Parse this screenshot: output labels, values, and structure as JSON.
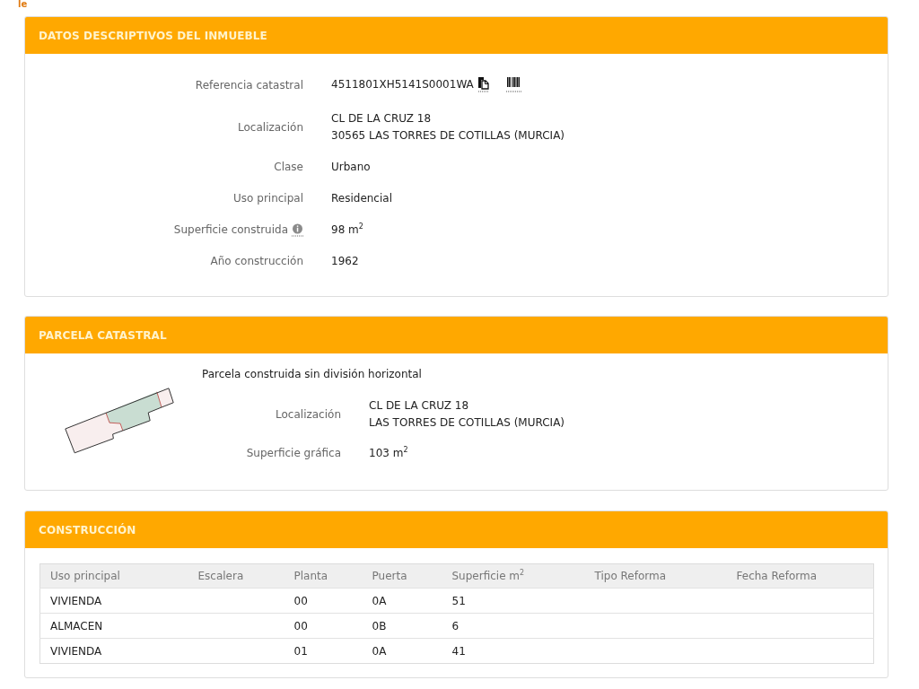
{
  "page_fragment": "le",
  "inmueble": {
    "title": "DATOS DESCRIPTIVOS DEL INMUEBLE",
    "fields": [
      {
        "kind": "reference",
        "label": "Referencia catastral",
        "lines": [
          "4511801XH5141S0001WA"
        ]
      },
      {
        "kind": "text",
        "label": "Localización",
        "lines": [
          "CL DE LA CRUZ 18",
          "30565 LAS TORRES DE COTILLAS (MURCIA)"
        ]
      },
      {
        "kind": "text",
        "label": "Clase",
        "lines": [
          "Urbano"
        ]
      },
      {
        "kind": "text",
        "label": "Uso principal",
        "lines": [
          "Residencial"
        ]
      },
      {
        "kind": "info",
        "label": "Superficie construida",
        "lines": [
          "98 m$^{2}$"
        ]
      },
      {
        "kind": "text",
        "label": "Año construcción",
        "lines": [
          "1962"
        ]
      }
    ]
  },
  "parcela": {
    "title": "PARCELA CATASTRAL",
    "subtitle": "Parcela construida sin división horizontal",
    "fields": [
      {
        "kind": "text",
        "label": "Localización",
        "lines": [
          "CL DE LA CRUZ 18",
          "LAS TORRES DE COTILLAS (MURCIA)"
        ]
      },
      {
        "kind": "text",
        "label": "Superficie gráfica",
        "lines": [
          "103 m$^{2}$"
        ]
      }
    ]
  },
  "construccion": {
    "title": "CONSTRUCCIÓN",
    "table": {
      "columns": [
        "Uso principal",
        "Escalera",
        "Planta",
        "Puerta",
        "Superficie m$^{2}$",
        "Tipo Reforma",
        "Fecha Reforma"
      ],
      "rows": [
        {
          "uso_principal": "VIVIENDA",
          "planta": "00",
          "puerta": "0A",
          "superficie": "51"
        },
        {
          "uso_principal": "ALMACEN",
          "planta": "00",
          "puerta": "0B",
          "superficie": "6"
        },
        {
          "uso_principal": "VIVIENDA",
          "planta": "01",
          "puerta": "0A",
          "superficie": "41"
        }
      ]
    }
  }
}
